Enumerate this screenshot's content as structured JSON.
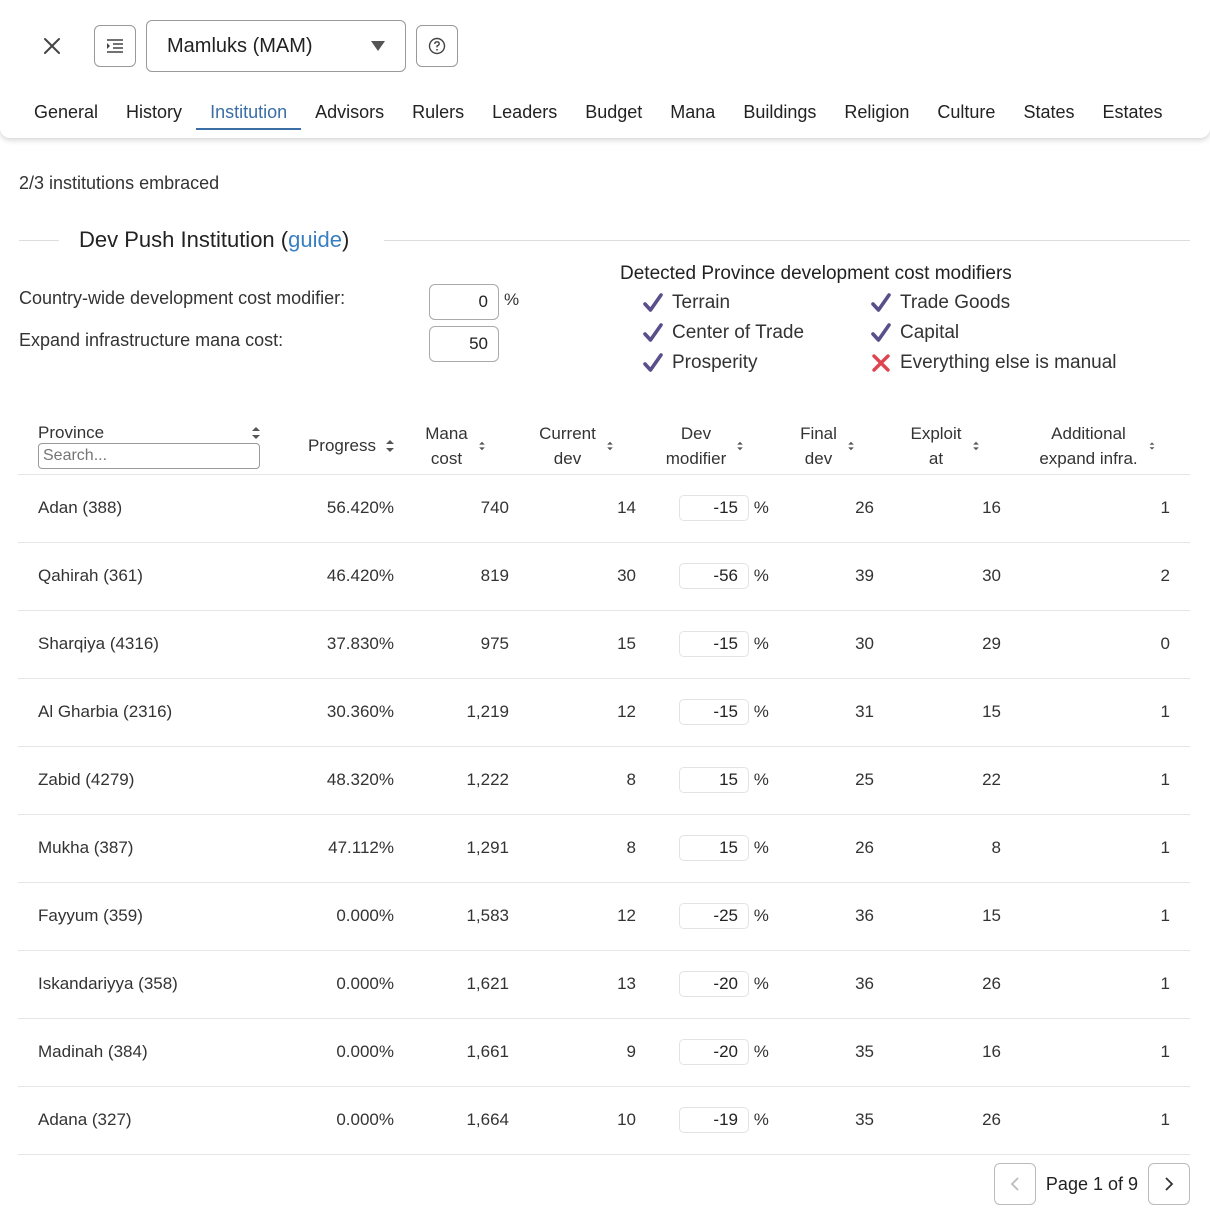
{
  "header": {
    "country_select": "Mamluks (MAM)",
    "tabs": [
      {
        "label": "General",
        "active": false
      },
      {
        "label": "History",
        "active": false
      },
      {
        "label": "Institution",
        "active": true
      },
      {
        "label": "Advisors",
        "active": false
      },
      {
        "label": "Rulers",
        "active": false
      },
      {
        "label": "Leaders",
        "active": false
      },
      {
        "label": "Budget",
        "active": false
      },
      {
        "label": "Mana",
        "active": false
      },
      {
        "label": "Buildings",
        "active": false
      },
      {
        "label": "Religion",
        "active": false
      },
      {
        "label": "Culture",
        "active": false
      },
      {
        "label": "States",
        "active": false
      },
      {
        "label": "Estates",
        "active": false
      }
    ]
  },
  "institutions_summary": "2/3 institutions embraced",
  "section": {
    "title": "Dev Push Institution (",
    "guide_link": "guide",
    "title_end": ")"
  },
  "settings": {
    "dev_cost_label": "Country-wide development cost modifier:",
    "dev_cost_value": "0",
    "dev_cost_unit": "%",
    "infra_label": "Expand infrastructure mana cost:",
    "infra_value": "50"
  },
  "detected": {
    "title": "Detected Province development cost modifiers",
    "items": [
      {
        "label": "Terrain",
        "status": "check"
      },
      {
        "label": "Trade Goods",
        "status": "check"
      },
      {
        "label": "Center of Trade",
        "status": "check"
      },
      {
        "label": "Capital",
        "status": "check"
      },
      {
        "label": "Prosperity",
        "status": "check"
      },
      {
        "label": "Everything else is manual",
        "status": "cross"
      }
    ]
  },
  "table": {
    "headers": {
      "province": "Province",
      "progress": "Progress",
      "mana_1": "Mana",
      "mana_2": "cost",
      "current_1": "Current",
      "current_2": "dev",
      "devmod_1": "Dev",
      "devmod_2": "modifier",
      "final_1": "Final",
      "final_2": "dev",
      "exploit_1": "Exploit",
      "exploit_2": "at",
      "infra_1": "Additional",
      "infra_2": "expand infra."
    },
    "search_placeholder": "Search...",
    "pct_unit": "%",
    "rows": [
      {
        "province": "Adan (388)",
        "progress": "56.420%",
        "mana": "740",
        "current": "14",
        "modifier": "-15",
        "final": "26",
        "exploit": "16",
        "infra": "1"
      },
      {
        "province": "Qahirah (361)",
        "progress": "46.420%",
        "mana": "819",
        "current": "30",
        "modifier": "-56",
        "final": "39",
        "exploit": "30",
        "infra": "2"
      },
      {
        "province": "Sharqiya (4316)",
        "progress": "37.830%",
        "mana": "975",
        "current": "15",
        "modifier": "-15",
        "final": "30",
        "exploit": "29",
        "infra": "0"
      },
      {
        "province": "Al Gharbia (2316)",
        "progress": "30.360%",
        "mana": "1,219",
        "current": "12",
        "modifier": "-15",
        "final": "31",
        "exploit": "15",
        "infra": "1"
      },
      {
        "province": "Zabid (4279)",
        "progress": "48.320%",
        "mana": "1,222",
        "current": "8",
        "modifier": "15",
        "final": "25",
        "exploit": "22",
        "infra": "1"
      },
      {
        "province": "Mukha (387)",
        "progress": "47.112%",
        "mana": "1,291",
        "current": "8",
        "modifier": "15",
        "final": "26",
        "exploit": "8",
        "infra": "1"
      },
      {
        "province": "Fayyum (359)",
        "progress": "0.000%",
        "mana": "1,583",
        "current": "12",
        "modifier": "-25",
        "final": "36",
        "exploit": "15",
        "infra": "1"
      },
      {
        "province": "Iskandariyya (358)",
        "progress": "0.000%",
        "mana": "1,621",
        "current": "13",
        "modifier": "-20",
        "final": "36",
        "exploit": "26",
        "infra": "1"
      },
      {
        "province": "Madinah (384)",
        "progress": "0.000%",
        "mana": "1,661",
        "current": "9",
        "modifier": "-20",
        "final": "35",
        "exploit": "16",
        "infra": "1"
      },
      {
        "province": "Adana (327)",
        "progress": "0.000%",
        "mana": "1,664",
        "current": "10",
        "modifier": "-19",
        "final": "35",
        "exploit": "26",
        "infra": "1"
      }
    ]
  },
  "pagination": {
    "label": "Page 1 of 9"
  },
  "colors": {
    "accent": "#3a6ea5",
    "link": "#3a7fc0",
    "check": "#5a4f8a",
    "cross": "#e0454f"
  }
}
